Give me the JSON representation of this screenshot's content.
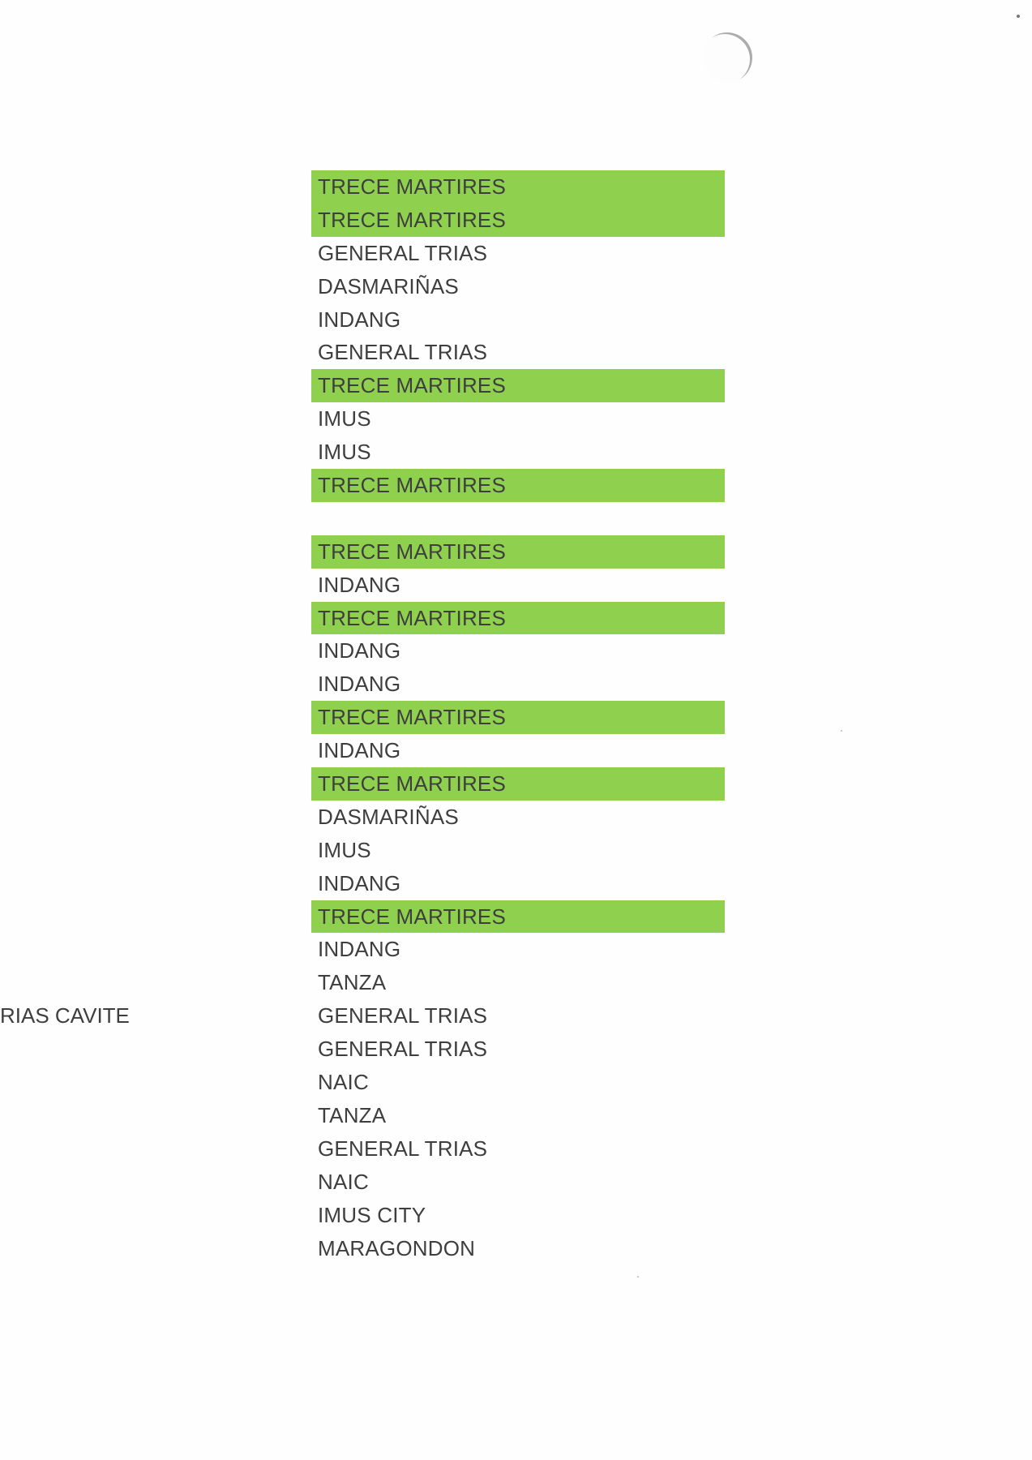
{
  "highlight_color": "#8fd14f",
  "left_fragment": "RIAS CAVITE",
  "rows": [
    {
      "text": "TRECE MARTIRES",
      "highlight": true
    },
    {
      "text": "TRECE MARTIRES",
      "highlight": true
    },
    {
      "text": "GENERAL TRIAS",
      "highlight": false
    },
    {
      "text": "DASMARIÑAS",
      "highlight": false
    },
    {
      "text": "INDANG",
      "highlight": false
    },
    {
      "text": "GENERAL TRIAS",
      "highlight": false
    },
    {
      "text": "TRECE MARTIRES",
      "highlight": true
    },
    {
      "text": "IMUS",
      "highlight": false
    },
    {
      "text": "IMUS",
      "highlight": false
    },
    {
      "text": "TRECE MARTIRES",
      "highlight": true
    },
    {
      "text": "",
      "highlight": false
    },
    {
      "text": "TRECE MARTIRES",
      "highlight": true
    },
    {
      "text": "INDANG",
      "highlight": false
    },
    {
      "text": "TRECE MARTIRES",
      "highlight": true
    },
    {
      "text": "INDANG",
      "highlight": false
    },
    {
      "text": "INDANG",
      "highlight": false
    },
    {
      "text": "TRECE MARTIRES",
      "highlight": true
    },
    {
      "text": "INDANG",
      "highlight": false
    },
    {
      "text": "TRECE MARTIRES",
      "highlight": true
    },
    {
      "text": "DASMARIÑAS",
      "highlight": false
    },
    {
      "text": "IMUS",
      "highlight": false
    },
    {
      "text": "INDANG",
      "highlight": false
    },
    {
      "text": "TRECE MARTIRES",
      "highlight": true
    },
    {
      "text": "INDANG",
      "highlight": false
    },
    {
      "text": "TANZA",
      "highlight": false
    },
    {
      "text": "GENERAL TRIAS",
      "highlight": false
    },
    {
      "text": "GENERAL TRIAS",
      "highlight": false
    },
    {
      "text": "NAIC",
      "highlight": false
    },
    {
      "text": "TANZA",
      "highlight": false
    },
    {
      "text": "GENERAL TRIAS",
      "highlight": false
    },
    {
      "text": "NAIC",
      "highlight": false
    },
    {
      "text": "IMUS CITY",
      "highlight": false
    },
    {
      "text": "MARAGONDON",
      "highlight": false
    }
  ]
}
